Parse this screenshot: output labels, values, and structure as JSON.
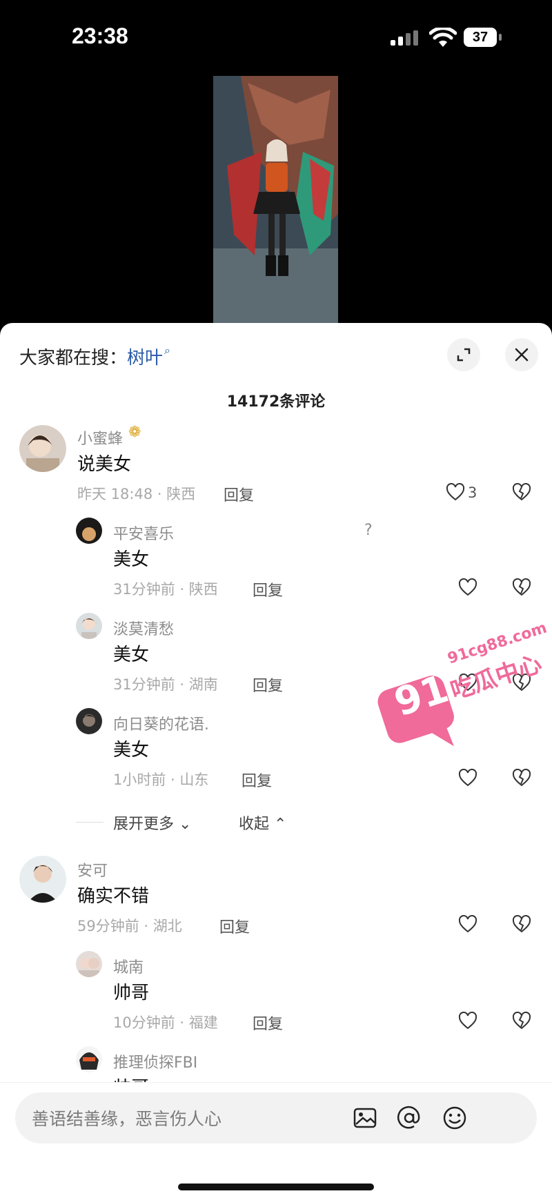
{
  "status_bar": {
    "time": "23:38",
    "battery": "37"
  },
  "header": {
    "search_prefix": "大家都在搜：",
    "search_term": "树叶",
    "comment_count": "14172条评论"
  },
  "comments": [
    {
      "user": "小蜜蜂",
      "text": "说美女",
      "meta": "昨天 18:48 · 陕西",
      "reply": "回复",
      "likes": "3",
      "replies": [
        {
          "user": "平安喜乐",
          "text": "美女",
          "meta": "31分钟前 · 陕西",
          "reply": "回复",
          "mark": "?"
        },
        {
          "user": "淡莫清愁",
          "text": "美女",
          "meta": "31分钟前 · 湖南",
          "reply": "回复"
        },
        {
          "user": "向日葵的花语.",
          "text": "美女",
          "meta": "1小时前 · 山东",
          "reply": "回复"
        }
      ],
      "expand_more": "展开更多",
      "collapse": "收起"
    },
    {
      "user": "安可",
      "text": "确实不错",
      "meta": "59分钟前 · 湖北",
      "reply": "回复",
      "replies": [
        {
          "user": "城南",
          "text": "帅哥",
          "meta": "10分钟前 · 福建",
          "reply": "回复"
        },
        {
          "user": "推理侦探FBI",
          "text": "帅哥",
          "meta": "",
          "reply": ""
        }
      ]
    }
  ],
  "watermark": {
    "number": "91",
    "domain": "91cg88.com",
    "name": "吃瓜中心"
  },
  "input": {
    "placeholder": "善语结善缘，恶言伤人心"
  },
  "colors": {
    "link": "#2a5aa8",
    "watermark": "#f06a9a"
  }
}
